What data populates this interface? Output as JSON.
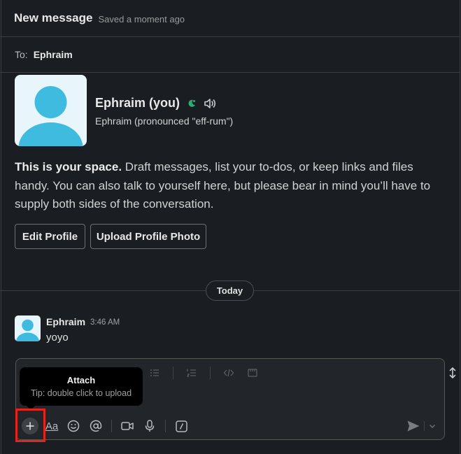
{
  "header": {
    "title": "New message",
    "saved": "Saved a moment ago"
  },
  "to": {
    "label": "To:",
    "recipient": "Ephraim"
  },
  "profile": {
    "name": "Ephraim (you)",
    "pronunciation": "Ephraim (pronounced \"eff-rum\")",
    "intro_bold": "This is your space.",
    "intro_rest": " Draft messages, list your to-dos, or keep links and files handy. You can also talk to yourself here, but please bear in mind you’ll have to supply both sides of the conversation.",
    "edit_button": "Edit Profile",
    "upload_button": "Upload Profile Photo"
  },
  "divider_label": "Today",
  "message": {
    "author": "Ephraim",
    "time": "3:46 AM",
    "text": "yoyo"
  },
  "composer": {
    "format_icons": [
      "bulleted-list-icon",
      "numbered-list-icon",
      "code-icon",
      "code-block-icon"
    ],
    "formatting_label": "Aa"
  },
  "tooltip": {
    "title": "Attach",
    "subtitle": "Tip: double click to upload"
  },
  "colors": {
    "background": "#1a1d21",
    "avatar_bg": "#e8f5fa",
    "avatar_fg": "#3fbbe0",
    "highlight": "#e2251d",
    "status": "#2bac76"
  }
}
